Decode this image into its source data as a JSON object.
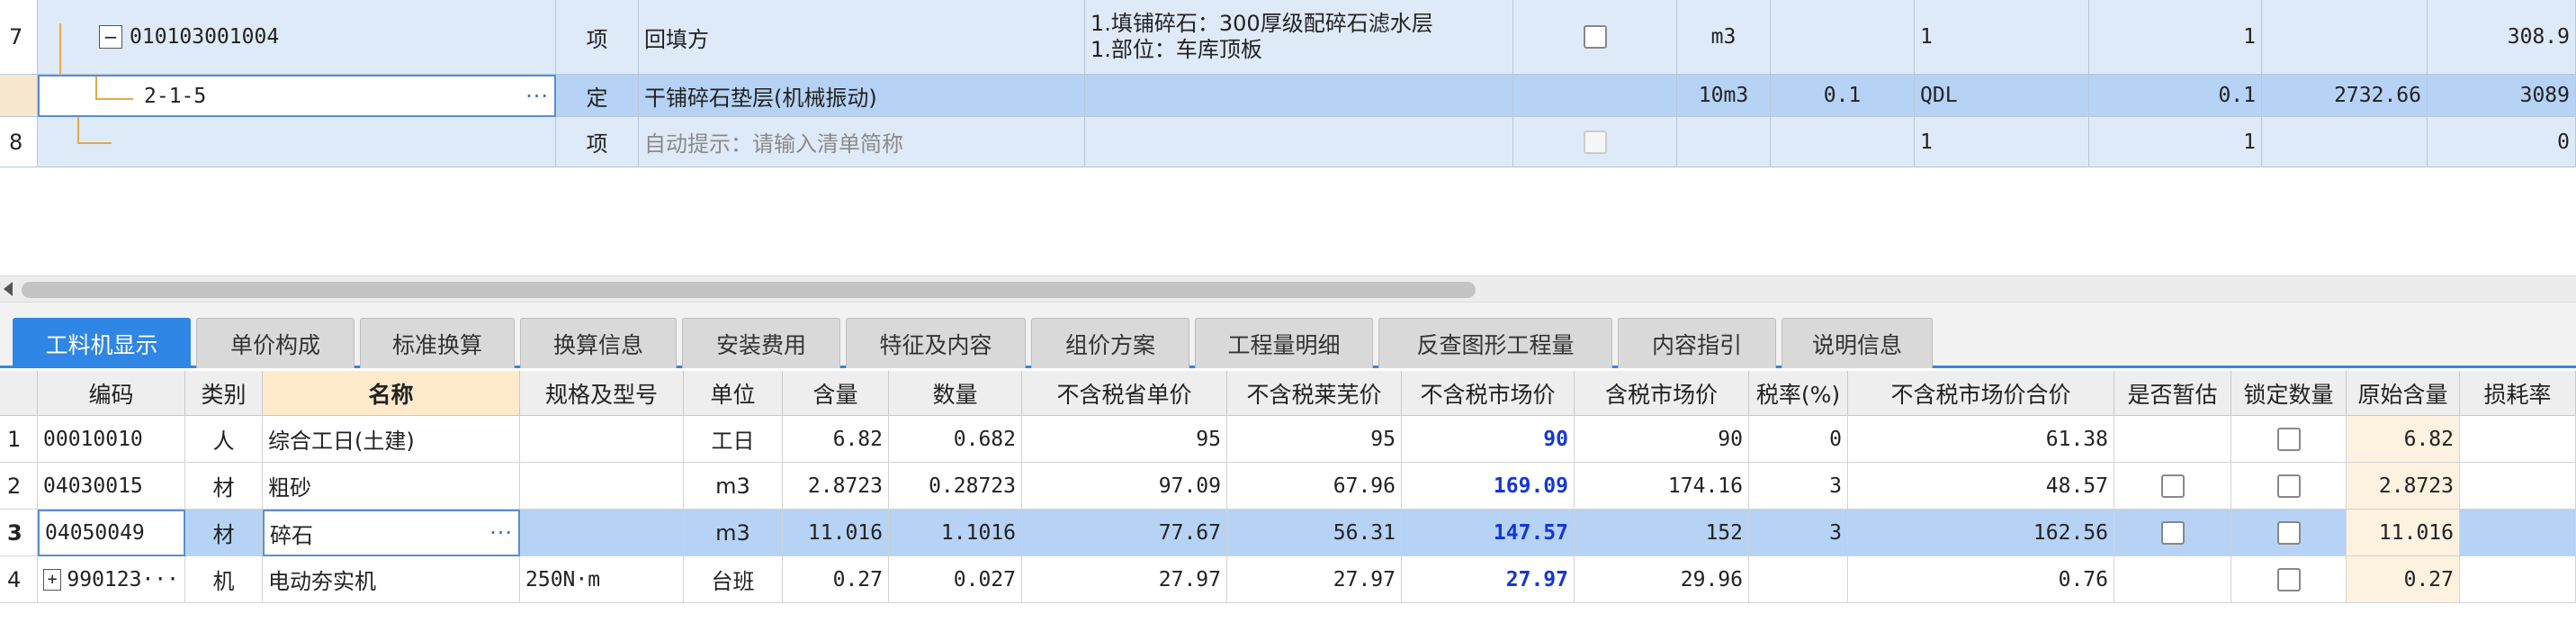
{
  "top_rows": [
    {
      "num": "7",
      "code": "010103001004",
      "kind": "项",
      "name": "回填方",
      "feature1": "1.填铺碎石：300厚级配碎石滤水层",
      "feature2": "1.部位：车库顶板",
      "unit": "m3",
      "qty_expr": "1",
      "qty": "1",
      "total": "308.9"
    },
    {
      "num": "",
      "code": "2-1-5",
      "kind": "定",
      "name": "干铺碎石垫层(机械振动)",
      "unit": "10m3",
      "content": "0.1",
      "qty_expr": "QDL",
      "qty": "0.1",
      "unit_price": "2732.66",
      "total": "3089"
    },
    {
      "num": "8",
      "code": "",
      "kind": "项",
      "name": "自动提示：请输入清单简称",
      "unit": "",
      "qty_expr": "1",
      "qty": "1",
      "total": "0"
    }
  ],
  "tabs": [
    "工料机显示",
    "单价构成",
    "标准换算",
    "换算信息",
    "安装费用",
    "特征及内容",
    "组价方案",
    "工程量明细",
    "反查图形工程量",
    "内容指引",
    "说明信息"
  ],
  "headers": [
    "编码",
    "类别",
    "名称",
    "规格及型号",
    "单位",
    "含量",
    "数量",
    "不含税省单价",
    "不含税莱芜价",
    "不含税市场价",
    "含税市场价",
    "税率(%)",
    "不含税市场价合价",
    "是否暂估",
    "锁定数量",
    "原始含量",
    "损耗率"
  ],
  "rows": [
    {
      "num": "1",
      "code": "00010010",
      "type": "人",
      "name": "综合工日(土建)",
      "spec": "",
      "unit": "工日",
      "content": "6.82",
      "qty": "0.682",
      "prov": "95",
      "laiwu": "95",
      "market": "90",
      "market_tax": "90",
      "tax": "0",
      "total": "61.38",
      "est": false,
      "orig": "6.82"
    },
    {
      "num": "2",
      "code": "04030015",
      "type": "材",
      "name": "粗砂",
      "spec": "",
      "unit": "m3",
      "content": "2.8723",
      "qty": "0.28723",
      "prov": "97.09",
      "laiwu": "67.96",
      "market": "169.09",
      "market_tax": "174.16",
      "tax": "3",
      "total": "48.57",
      "est": true,
      "orig": "2.8723"
    },
    {
      "num": "3",
      "code": "04050049",
      "type": "材",
      "name": "碎石",
      "spec": "",
      "unit": "m3",
      "content": "11.016",
      "qty": "1.1016",
      "prov": "77.67",
      "laiwu": "56.31",
      "market": "147.57",
      "market_tax": "152",
      "tax": "3",
      "total": "162.56",
      "est": true,
      "orig": "11.016"
    },
    {
      "num": "4",
      "code": "990123···",
      "type": "机",
      "name": "电动夯实机",
      "spec": "250N·m",
      "unit": "台班",
      "content": "0.27",
      "qty": "0.027",
      "prov": "27.97",
      "laiwu": "27.97",
      "market": "27.97",
      "market_tax": "29.96",
      "tax": "",
      "total": "0.76",
      "est": false,
      "orig": "0.27"
    }
  ],
  "icons": {
    "collapse": "minus-box-icon",
    "expand": "plus-box-icon",
    "ellipsis": "ellipsis-icon",
    "scroll_left": "triangle-left-icon"
  }
}
